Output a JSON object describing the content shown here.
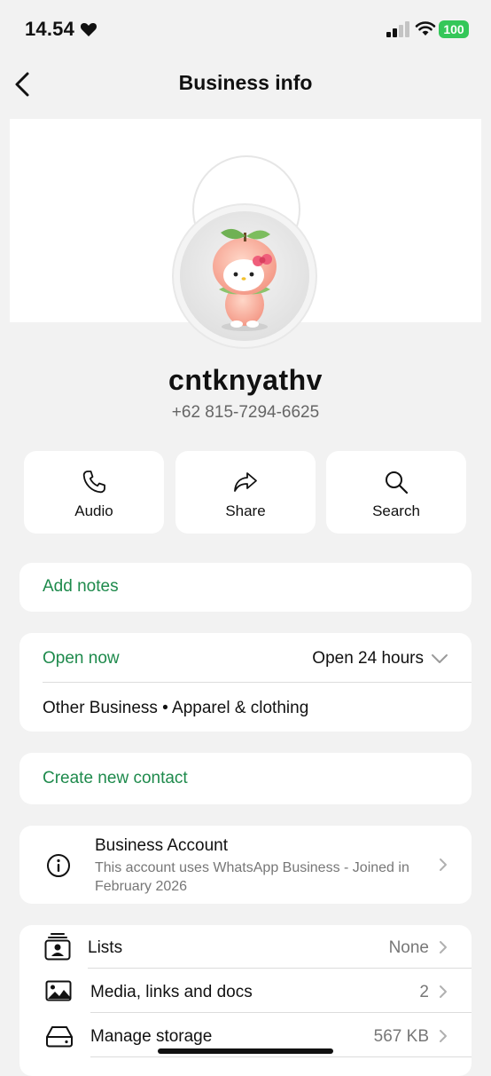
{
  "status_bar": {
    "time": "14.54",
    "battery": "100"
  },
  "nav": {
    "title": "Business info"
  },
  "profile": {
    "name": "cntknyathv",
    "phone": "+62 815-7294-6625"
  },
  "actions": [
    {
      "label": "Audio",
      "icon": "phone-icon"
    },
    {
      "label": "Share",
      "icon": "share-icon"
    },
    {
      "label": "Search",
      "icon": "search-icon"
    }
  ],
  "notes": {
    "label": "Add notes"
  },
  "hours": {
    "status": "Open now",
    "schedule": "Open 24 hours",
    "category": "Other Business • Apparel & clothing"
  },
  "contact": {
    "label": "Create new contact"
  },
  "business_account": {
    "title": "Business Account",
    "description": "This account uses WhatsApp Business - Joined in February 2026"
  },
  "list_rows": [
    {
      "label": "Lists",
      "value": "None",
      "icon": "lists-icon"
    },
    {
      "label": "Media, links and docs",
      "value": "2",
      "icon": "media-icon"
    },
    {
      "label": "Manage storage",
      "value": "567 KB",
      "icon": "storage-icon"
    }
  ],
  "colors": {
    "accent_green": "#1e8a4c",
    "battery_green": "#34c759",
    "background": "#f2f2f2"
  }
}
